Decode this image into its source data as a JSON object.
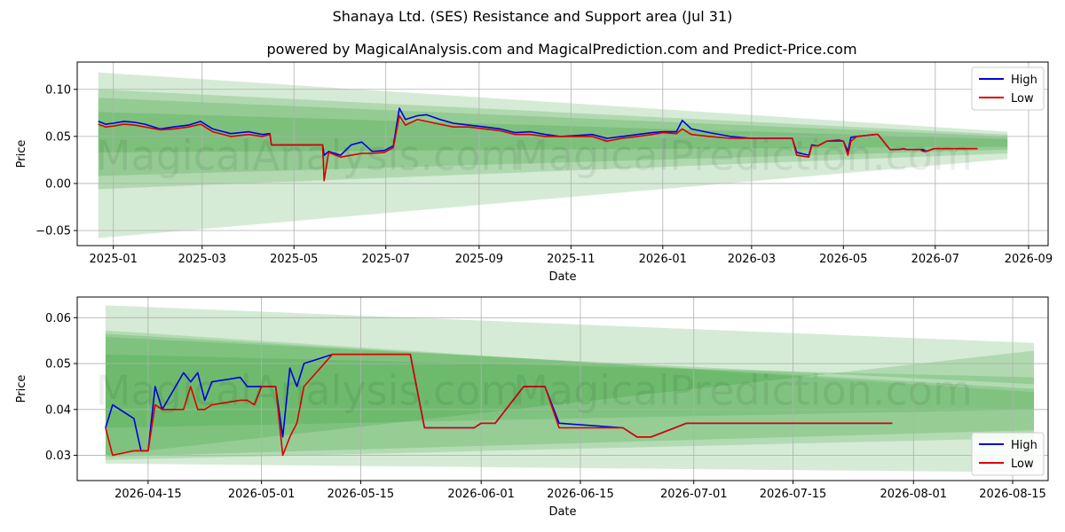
{
  "title": "Shanaya Ltd. (SES) Resistance and Support area (Jul 31)",
  "subtitle": "powered by MagicalAnalysis.com and MagicalPrediction.com and Predict-Price.com",
  "watermarks": [
    "MagicalAnalysis.com",
    "MagicalPrediction.com"
  ],
  "colors": {
    "high": "#0000dd",
    "low": "#dd0000",
    "band": "#2e9a2e",
    "grid": "#b0b0b0"
  },
  "chart_data": [
    {
      "type": "line",
      "xlabel": "Date",
      "ylabel": "Price",
      "x_ticks": [
        "2025-01",
        "2025-03",
        "2025-05",
        "2025-07",
        "2025-09",
        "2025-11",
        "2026-01",
        "2026-03",
        "2026-05",
        "2026-07",
        "2026-09"
      ],
      "y_ticks": [
        "0.10",
        "0.05",
        "0.00",
        "−0.05"
      ],
      "xlim": [
        "2024-12-08",
        "2026-09-14"
      ],
      "ylim": [
        -0.066,
        0.129
      ],
      "legend": "top-right",
      "grid": true,
      "bands": [
        {
          "x": [
            "2024-12-22",
            "2026-08-18"
          ],
          "upper": [
            0.118,
            0.055
          ],
          "lower": [
            -0.058,
            0.026
          ],
          "opacity": 0.2
        },
        {
          "x": [
            "2024-12-22",
            "2026-08-18"
          ],
          "upper": [
            0.1,
            0.052
          ],
          "lower": [
            -0.006,
            0.032
          ],
          "opacity": 0.22
        },
        {
          "x": [
            "2024-12-22",
            "2026-08-18"
          ],
          "upper": [
            0.091,
            0.05
          ],
          "lower": [
            0.008,
            0.036
          ],
          "opacity": 0.22
        },
        {
          "x": [
            "2024-12-22",
            "2026-08-18"
          ],
          "upper": [
            0.076,
            0.047
          ],
          "lower": [
            0.033,
            0.039
          ],
          "opacity": 0.22
        }
      ],
      "series": [
        {
          "name": "High",
          "x": [
            "2024-12-22",
            "2024-12-27",
            "2025-01-01",
            "2025-01-08",
            "2025-01-15",
            "2025-01-22",
            "2025-02-01",
            "2025-02-10",
            "2025-02-20",
            "2025-02-28",
            "2025-03-08",
            "2025-03-20",
            "2025-04-01",
            "2025-04-10",
            "2025-04-15",
            "2025-04-16",
            "2025-05-10",
            "2025-05-20",
            "2025-05-21",
            "2025-05-24",
            "2025-06-01",
            "2025-06-08",
            "2025-06-15",
            "2025-06-22",
            "2025-06-30",
            "2025-07-06",
            "2025-07-10",
            "2025-07-14",
            "2025-07-22",
            "2025-07-28",
            "2025-08-06",
            "2025-08-15",
            "2025-08-25",
            "2025-09-05",
            "2025-09-15",
            "2025-09-25",
            "2025-10-05",
            "2025-10-15",
            "2025-10-25",
            "2025-11-05",
            "2025-11-15",
            "2025-11-25",
            "2025-12-05",
            "2025-12-15",
            "2025-12-25",
            "2026-01-01",
            "2026-01-10",
            "2026-01-14",
            "2026-01-20",
            "2026-02-01",
            "2026-02-15",
            "2026-03-01",
            "2026-03-10",
            "2026-03-20",
            "2026-03-28",
            "2026-03-31",
            "2026-04-08",
            "2026-04-10",
            "2026-04-14",
            "2026-04-20",
            "2026-04-28",
            "2026-05-01",
            "2026-05-04",
            "2026-05-06",
            "2026-05-10",
            "2026-05-22",
            "2026-05-24",
            "2026-06-01",
            "2026-06-03",
            "2026-06-07",
            "2026-06-10",
            "2026-06-12",
            "2026-06-21",
            "2026-06-23",
            "2026-06-25",
            "2026-06-30",
            "2026-07-29"
          ],
          "values": [
            0.066,
            0.063,
            0.064,
            0.066,
            0.065,
            0.063,
            0.058,
            0.06,
            0.062,
            0.066,
            0.058,
            0.053,
            0.055,
            0.052,
            0.053,
            0.041,
            0.041,
            0.041,
            0.03,
            0.034,
            0.03,
            0.041,
            0.044,
            0.034,
            0.035,
            0.04,
            0.08,
            0.068,
            0.072,
            0.073,
            0.068,
            0.064,
            0.062,
            0.06,
            0.058,
            0.054,
            0.055,
            0.052,
            0.05,
            0.051,
            0.052,
            0.048,
            0.05,
            0.052,
            0.054,
            0.055,
            0.055,
            0.067,
            0.058,
            0.054,
            0.05,
            0.048,
            0.048,
            0.048,
            0.048,
            0.033,
            0.03,
            0.041,
            0.04,
            0.045,
            0.046,
            0.045,
            0.034,
            0.049,
            0.05,
            0.052,
            0.052,
            0.036,
            0.036,
            0.036,
            0.037,
            0.036,
            0.036,
            0.036,
            0.034,
            0.037,
            0.037
          ]
        },
        {
          "name": "Low",
          "x": [
            "2024-12-22",
            "2024-12-27",
            "2025-01-01",
            "2025-01-08",
            "2025-01-15",
            "2025-01-22",
            "2025-02-01",
            "2025-02-10",
            "2025-02-20",
            "2025-02-28",
            "2025-03-08",
            "2025-03-20",
            "2025-04-01",
            "2025-04-10",
            "2025-04-15",
            "2025-04-16",
            "2025-05-10",
            "2025-05-20",
            "2025-05-21",
            "2025-05-24",
            "2025-06-01",
            "2025-06-08",
            "2025-06-15",
            "2025-06-22",
            "2025-06-30",
            "2025-07-06",
            "2025-07-10",
            "2025-07-14",
            "2025-07-22",
            "2025-07-28",
            "2025-08-06",
            "2025-08-15",
            "2025-08-25",
            "2025-09-05",
            "2025-09-15",
            "2025-09-25",
            "2025-10-05",
            "2025-10-15",
            "2025-10-25",
            "2025-11-05",
            "2025-11-15",
            "2025-11-25",
            "2025-12-05",
            "2025-12-15",
            "2025-12-25",
            "2026-01-01",
            "2026-01-10",
            "2026-01-14",
            "2026-01-20",
            "2026-02-01",
            "2026-02-15",
            "2026-03-01",
            "2026-03-10",
            "2026-03-20",
            "2026-03-28",
            "2026-03-31",
            "2026-04-08",
            "2026-04-10",
            "2026-04-14",
            "2026-04-20",
            "2026-04-28",
            "2026-05-01",
            "2026-05-04",
            "2026-05-06",
            "2026-05-10",
            "2026-05-22",
            "2026-05-24",
            "2026-06-01",
            "2026-06-03",
            "2026-06-07",
            "2026-06-10",
            "2026-06-12",
            "2026-06-21",
            "2026-06-23",
            "2026-06-25",
            "2026-06-30",
            "2026-07-29"
          ],
          "values": [
            0.063,
            0.06,
            0.061,
            0.063,
            0.062,
            0.06,
            0.057,
            0.058,
            0.06,
            0.063,
            0.055,
            0.05,
            0.052,
            0.05,
            0.052,
            0.041,
            0.041,
            0.041,
            0.003,
            0.033,
            0.028,
            0.03,
            0.032,
            0.032,
            0.033,
            0.038,
            0.072,
            0.062,
            0.068,
            0.066,
            0.063,
            0.06,
            0.06,
            0.058,
            0.056,
            0.052,
            0.052,
            0.05,
            0.05,
            0.05,
            0.05,
            0.045,
            0.048,
            0.05,
            0.052,
            0.054,
            0.053,
            0.058,
            0.052,
            0.05,
            0.048,
            0.048,
            0.048,
            0.048,
            0.048,
            0.03,
            0.028,
            0.04,
            0.04,
            0.045,
            0.045,
            0.045,
            0.03,
            0.045,
            0.05,
            0.052,
            0.052,
            0.036,
            0.036,
            0.036,
            0.037,
            0.036,
            0.036,
            0.034,
            0.034,
            0.037,
            0.037
          ]
        }
      ]
    },
    {
      "type": "line",
      "xlabel": "Date",
      "ylabel": "Price",
      "x_ticks": [
        "2026-04-15",
        "2026-05-01",
        "2026-05-15",
        "2026-06-01",
        "2026-06-15",
        "2026-07-01",
        "2026-07-15",
        "2026-08-01",
        "2026-08-15"
      ],
      "y_ticks": [
        "0.06",
        "0.05",
        "0.04",
        "0.03"
      ],
      "xlim": [
        "2026-04-05",
        "2026-08-20"
      ],
      "ylim": [
        0.0245,
        0.0645
      ],
      "legend": "bottom-right",
      "grid": true,
      "bands": [
        {
          "x": [
            "2026-04-09",
            "2026-08-18"
          ],
          "upper": [
            0.0627,
            0.0545
          ],
          "lower": [
            0.0282,
            0.0263
          ],
          "opacity": 0.2
        },
        {
          "x": [
            "2026-04-09",
            "2026-08-18"
          ],
          "upper": [
            0.0572,
            0.0438
          ],
          "lower": [
            0.029,
            0.0338
          ],
          "opacity": 0.2
        },
        {
          "x": [
            "2026-04-09",
            "2026-08-18"
          ],
          "upper": [
            0.0565,
            0.0445
          ],
          "lower": [
            0.0297,
            0.0355
          ],
          "opacity": 0.22
        },
        {
          "x": [
            "2026-04-09",
            "2026-08-18"
          ],
          "upper": [
            0.0558,
            0.0455
          ],
          "lower": [
            0.03,
            0.0528
          ],
          "opacity": 0.22
        },
        {
          "x": [
            "2026-04-09",
            "2026-08-18"
          ],
          "upper": [
            0.052,
            0.047
          ],
          "lower": [
            0.036,
            0.04
          ],
          "opacity": 0.2
        }
      ],
      "series": [
        {
          "name": "High",
          "x": [
            "2026-04-09",
            "2026-04-10",
            "2026-04-13",
            "2026-04-14",
            "2026-04-15",
            "2026-04-16",
            "2026-04-17",
            "2026-04-20",
            "2026-04-21",
            "2026-04-22",
            "2026-04-23",
            "2026-04-24",
            "2026-04-28",
            "2026-04-29",
            "2026-04-30",
            "2026-05-01",
            "2026-05-02",
            "2026-05-03",
            "2026-05-04",
            "2026-05-05",
            "2026-05-06",
            "2026-05-07",
            "2026-05-11",
            "2026-05-22",
            "2026-05-24",
            "2026-05-31",
            "2026-06-01",
            "2026-06-03",
            "2026-06-07",
            "2026-06-10",
            "2026-06-12",
            "2026-06-21",
            "2026-06-23",
            "2026-06-25",
            "2026-06-30",
            "2026-07-29"
          ],
          "values": [
            0.036,
            0.041,
            0.038,
            0.031,
            0.031,
            0.045,
            0.04,
            0.048,
            0.046,
            0.048,
            0.042,
            0.046,
            0.047,
            0.045,
            0.045,
            0.045,
            0.045,
            0.045,
            0.034,
            0.049,
            0.045,
            0.05,
            0.052,
            0.052,
            0.036,
            0.036,
            0.037,
            0.037,
            0.045,
            0.045,
            0.037,
            0.036,
            0.034,
            0.034,
            0.037,
            0.037
          ]
        },
        {
          "name": "Low",
          "x": [
            "2026-04-09",
            "2026-04-10",
            "2026-04-13",
            "2026-04-14",
            "2026-04-15",
            "2026-04-16",
            "2026-04-17",
            "2026-04-20",
            "2026-04-21",
            "2026-04-22",
            "2026-04-23",
            "2026-04-24",
            "2026-04-28",
            "2026-04-29",
            "2026-04-30",
            "2026-05-01",
            "2026-05-02",
            "2026-05-03",
            "2026-05-04",
            "2026-05-05",
            "2026-05-06",
            "2026-05-07",
            "2026-05-11",
            "2026-05-22",
            "2026-05-24",
            "2026-05-31",
            "2026-06-01",
            "2026-06-03",
            "2026-06-07",
            "2026-06-10",
            "2026-06-12",
            "2026-06-21",
            "2026-06-23",
            "2026-06-25",
            "2026-06-30",
            "2026-07-29"
          ],
          "values": [
            0.036,
            0.03,
            0.031,
            0.031,
            0.031,
            0.041,
            0.04,
            0.04,
            0.045,
            0.04,
            0.04,
            0.041,
            0.042,
            0.042,
            0.041,
            0.045,
            0.045,
            0.045,
            0.03,
            0.034,
            0.037,
            0.045,
            0.052,
            0.052,
            0.036,
            0.036,
            0.037,
            0.037,
            0.045,
            0.045,
            0.036,
            0.036,
            0.034,
            0.034,
            0.037,
            0.037
          ]
        }
      ]
    }
  ]
}
